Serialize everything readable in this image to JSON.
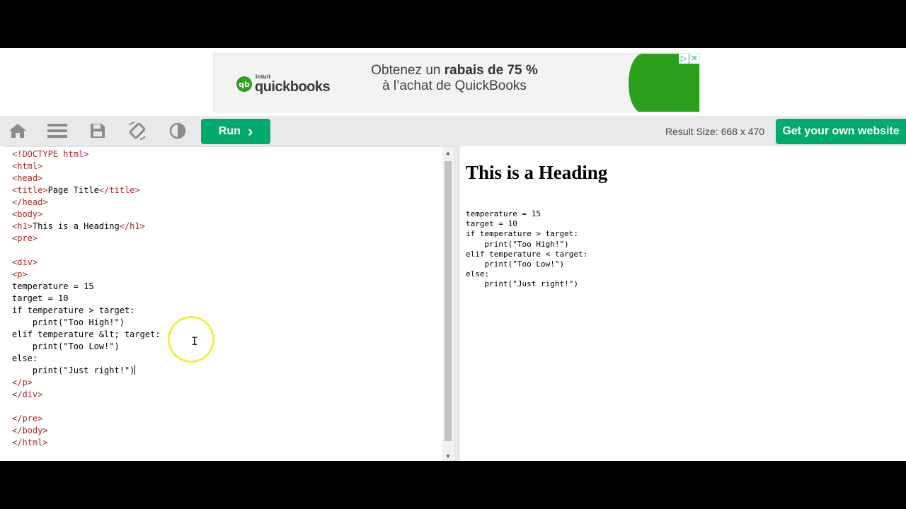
{
  "ad": {
    "brand_prefix": "intuit",
    "brand_name": "quickbooks",
    "logo_mark": "qb",
    "headline_part1": "Obtenez un ",
    "headline_bold": "rabais de 75 %",
    "headline_line2": "à l’achat de QuickBooks",
    "badge_play": "▷",
    "badge_close": "✕",
    "accent_color": "#2ca01c"
  },
  "toolbar": {
    "icons": [
      "home-icon",
      "menu-icon",
      "save-icon",
      "rotate-icon",
      "contrast-icon"
    ],
    "run_label": "Run",
    "run_chevron": "›",
    "result_size": "Result Size: 668 x 470",
    "get_website_label": "Get your own website",
    "accent_color": "#04aa6d"
  },
  "editor": {
    "lines": [
      "<!DOCTYPE html>",
      "<html>",
      "<head>",
      "<title>Page Title</title>",
      "</head>",
      "<body>",
      "<h1>This is a Heading</h1>",
      "<pre>",
      "",
      "<div>",
      "<p>",
      "temperature = 15",
      "target = 10",
      "if temperature > target:",
      "    print(\"Too High!\")",
      "elif temperature &lt; target:",
      "    print(\"Too Low!\")",
      "else:",
      "    print(\"Just right!\")",
      "</p>",
      "</div>",
      "",
      "</pre>",
      "</body>",
      "</html>"
    ],
    "scroll_up": "▲",
    "scroll_down": "▼"
  },
  "result": {
    "heading": "This is a Heading",
    "pre_text": "temperature = 15\ntarget = 10\nif temperature > target:\n    print(\"Too High!\")\nelif temperature < target:\n    print(\"Too Low!\")\nelse:\n    print(\"Just right!\")"
  },
  "cursor": {
    "glyph": "I"
  }
}
